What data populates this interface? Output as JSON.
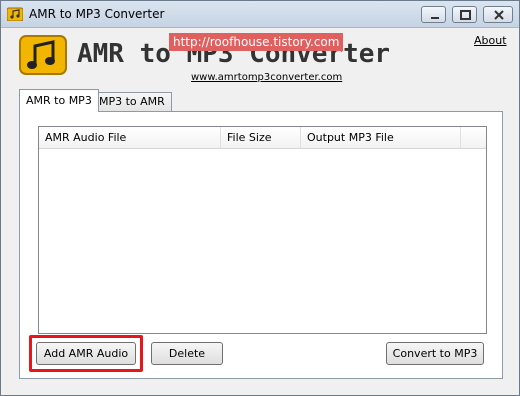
{
  "window": {
    "title": "AMR to MP3 Converter",
    "minimize_icon": "minimize-icon",
    "maximize_icon": "maximize-icon",
    "close_icon": "close-icon"
  },
  "header": {
    "app_name": "AMR to MP3 Converter",
    "watermark": "http://roofhouse.tistory.com",
    "website": "www.amrtomp3converter.com",
    "about": "About",
    "logo_icon": "music-note-icon"
  },
  "tabs": [
    {
      "label": "AMR to MP3",
      "active": true
    },
    {
      "label": "MP3 to AMR",
      "active": false
    }
  ],
  "file_list": {
    "columns": [
      "AMR Audio File",
      "File Size",
      "Output MP3 File"
    ],
    "rows": []
  },
  "buttons": {
    "add": "Add AMR Audio",
    "delete": "Delete",
    "convert": "Convert to MP3"
  },
  "colors": {
    "highlight": "#e8161a",
    "watermark_bg": "#e06060",
    "logo": "#f2b500"
  }
}
